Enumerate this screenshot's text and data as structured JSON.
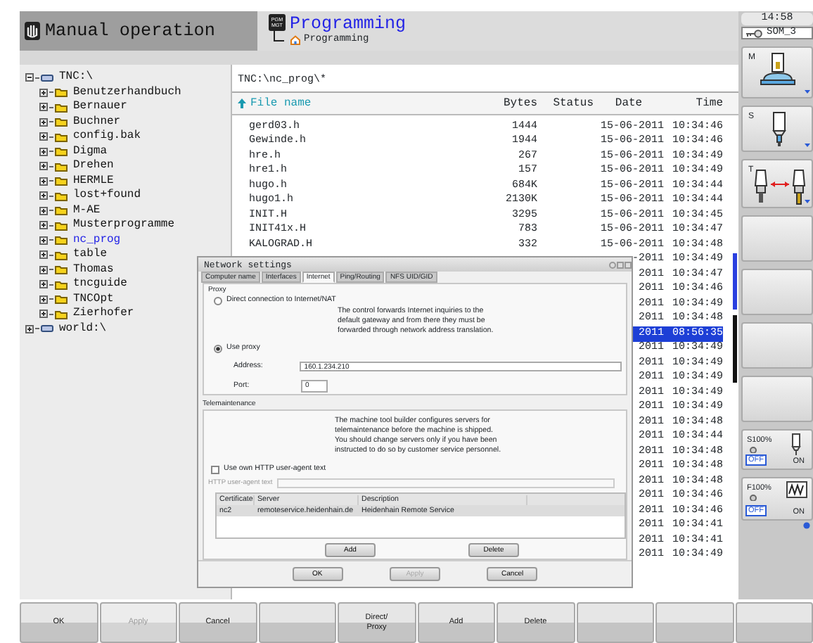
{
  "header": {
    "mode": "Manual operation",
    "program_title": "Programming",
    "program_subtitle": "Programming",
    "clock": "14:58",
    "user": "SOM_3",
    "pgm_key": [
      "PGM",
      "MGT"
    ]
  },
  "tree": [
    {
      "label": "TNC:\\",
      "kind": "drive",
      "selected": false,
      "expanded": true,
      "children": [
        {
          "label": "Benutzerhandbuch",
          "kind": "folder",
          "selected": false,
          "expanded": false
        },
        {
          "label": "Bernauer",
          "kind": "folder",
          "selected": false,
          "expanded": false
        },
        {
          "label": "Buchner",
          "kind": "folder",
          "selected": false,
          "expanded": false
        },
        {
          "label": "config.bak",
          "kind": "folder",
          "selected": false,
          "expanded": false
        },
        {
          "label": "Digma",
          "kind": "folder",
          "selected": false,
          "expanded": false
        },
        {
          "label": "Drehen",
          "kind": "folder",
          "selected": false,
          "expanded": false
        },
        {
          "label": "HERMLE",
          "kind": "folder",
          "selected": false,
          "expanded": false
        },
        {
          "label": "lost+found",
          "kind": "folder",
          "selected": false,
          "expanded": false
        },
        {
          "label": "M-AE",
          "kind": "folder",
          "selected": false,
          "expanded": false
        },
        {
          "label": "Musterprogramme",
          "kind": "folder",
          "selected": false,
          "expanded": false
        },
        {
          "label": "nc_prog",
          "kind": "folder",
          "selected": true,
          "expanded": false
        },
        {
          "label": "table",
          "kind": "folder",
          "selected": false,
          "expanded": false
        },
        {
          "label": "Thomas",
          "kind": "folder",
          "selected": false,
          "expanded": false
        },
        {
          "label": "tncguide",
          "kind": "folder",
          "selected": false,
          "expanded": false
        },
        {
          "label": "TNCOpt",
          "kind": "folder",
          "selected": false,
          "expanded": false
        },
        {
          "label": "Zierhofer",
          "kind": "folder",
          "selected": false,
          "expanded": false
        }
      ]
    },
    {
      "label": "world:\\",
      "kind": "drive",
      "selected": false,
      "expanded": false
    }
  ],
  "file_list": {
    "path": "TNC:\\nc_prog\\*",
    "columns": [
      "File name",
      "Bytes",
      "Status",
      "Date",
      "Time"
    ],
    "rows": [
      {
        "name": "gerd03.h",
        "bytes": "1444",
        "date": "15-06-2011",
        "time": "10:34:46",
        "selected": false
      },
      {
        "name": "Gewinde.h",
        "bytes": "1944",
        "date": "15-06-2011",
        "time": "10:34:46",
        "selected": false
      },
      {
        "name": "hre.h",
        "bytes": "267",
        "date": "15-06-2011",
        "time": "10:34:49",
        "selected": false
      },
      {
        "name": "hre1.h",
        "bytes": "157",
        "date": "15-06-2011",
        "time": "10:34:49",
        "selected": false
      },
      {
        "name": "hugo.h",
        "bytes": "684K",
        "date": "15-06-2011",
        "time": "10:34:44",
        "selected": false
      },
      {
        "name": "hugo1.h",
        "bytes": "2130K",
        "date": "15-06-2011",
        "time": "10:34:44",
        "selected": false
      },
      {
        "name": "INIT.H",
        "bytes": "3295",
        "date": "15-06-2011",
        "time": "10:34:45",
        "selected": false
      },
      {
        "name": "INIT41x.H",
        "bytes": "783",
        "date": "15-06-2011",
        "time": "10:34:47",
        "selected": false
      },
      {
        "name": "KALOGRAD.H",
        "bytes": "332",
        "date": "15-06-2011",
        "time": "10:34:48",
        "selected": false
      },
      {
        "date": "-2011",
        "time": "10:34:49",
        "selected": false
      },
      {
        "date": "2011",
        "time": "10:34:47",
        "selected": false
      },
      {
        "date": "2011",
        "time": "10:34:46",
        "selected": false
      },
      {
        "date": "2011",
        "time": "10:34:49",
        "selected": false
      },
      {
        "date": "2011",
        "time": "10:34:48",
        "selected": false
      },
      {
        "date": "2011",
        "time": "08:56:35",
        "selected": true
      },
      {
        "date": "2011",
        "time": "10:34:49",
        "selected": false
      },
      {
        "date": "2011",
        "time": "10:34:49",
        "selected": false
      },
      {
        "date": "2011",
        "time": "10:34:49",
        "selected": false
      },
      {
        "date": "2011",
        "time": "10:34:49",
        "selected": false
      },
      {
        "date": "2011",
        "time": "10:34:49",
        "selected": false
      },
      {
        "date": "2011",
        "time": "10:34:48",
        "selected": false
      },
      {
        "date": "2011",
        "time": "10:34:44",
        "selected": false
      },
      {
        "date": "2011",
        "time": "10:34:48",
        "selected": false
      },
      {
        "date": "2011",
        "time": "10:34:48",
        "selected": false
      },
      {
        "date": "2011",
        "time": "10:34:48",
        "selected": false
      },
      {
        "date": "2011",
        "time": "10:34:46",
        "selected": false
      },
      {
        "date": "2011",
        "time": "10:34:46",
        "selected": false
      },
      {
        "date": "2011",
        "time": "10:34:41",
        "selected": false
      },
      {
        "date": "2011",
        "time": "10:34:41",
        "selected": false
      },
      {
        "date": "2011",
        "time": "10:34:49",
        "selected": false
      }
    ]
  },
  "sidebar": [
    {
      "kind": "m",
      "label": "M"
    },
    {
      "kind": "s",
      "label": "S"
    },
    {
      "kind": "t",
      "label": "T"
    },
    {
      "kind": "blank"
    },
    {
      "kind": "blank"
    },
    {
      "kind": "blank"
    },
    {
      "kind": "blank"
    },
    {
      "kind": "spindle-override",
      "label": "S100%",
      "off": "OFF",
      "on": "ON"
    },
    {
      "kind": "feed-override",
      "label": "F100%",
      "off": "OFF",
      "on": "ON"
    }
  ],
  "dialog": {
    "title": "Network settings",
    "tabs": [
      {
        "label": "Computer name",
        "selected": false
      },
      {
        "label": "Interfaces",
        "selected": false
      },
      {
        "label": "Internet",
        "selected": true
      },
      {
        "label": "Ping/Routing",
        "selected": false
      },
      {
        "label": "NFS UID/GID",
        "selected": false
      }
    ],
    "proxy": {
      "title": "Proxy",
      "options": [
        {
          "label": "Direct connection to Internet/NAT",
          "selected": false
        },
        {
          "label": "Use proxy",
          "selected": true
        }
      ],
      "note": "The control forwards Internet inquiries to the default gateway and from there they must be forwarded through network address translation.",
      "address_label": "Address:",
      "address": "160.1.234.210",
      "port_label": "Port:",
      "port": "0"
    },
    "telemaintenance": {
      "title": "Telemaintenance",
      "note": "The machine tool builder configures servers for telemaintenance before the machine is shipped. You should change servers only if you have been instructed to do so by customer service personnel.",
      "checkbox": {
        "label": "Use own HTTP user-agent text",
        "checked": false
      },
      "agent_label": "HTTP user-agent text",
      "columns": [
        "Certificate",
        "Server",
        "Description"
      ],
      "rows": [
        {
          "cells": [
            "nc2",
            "remoteservice.heidenhain.de",
            "Heidenhain Remote Service"
          ],
          "selected": true
        }
      ],
      "buttons": [
        {
          "label": "Add",
          "disabled": false
        },
        {
          "label": "Delete",
          "disabled": false
        }
      ]
    },
    "buttons": [
      {
        "label": "OK",
        "disabled": false
      },
      {
        "label": "Apply",
        "disabled": true
      },
      {
        "label": "Cancel",
        "disabled": false
      }
    ]
  },
  "softkeys": [
    {
      "label": "OK",
      "disabled": false
    },
    {
      "label": "Apply",
      "disabled": true
    },
    {
      "label": "Cancel",
      "disabled": false
    },
    {
      "disabled": false
    },
    {
      "label": "Direct/ Proxy",
      "disabled": false
    },
    {
      "label": "Add",
      "disabled": false
    },
    {
      "label": "Delete",
      "disabled": false
    },
    {
      "disabled": false
    },
    {
      "disabled": false
    },
    {
      "disabled": false
    }
  ]
}
